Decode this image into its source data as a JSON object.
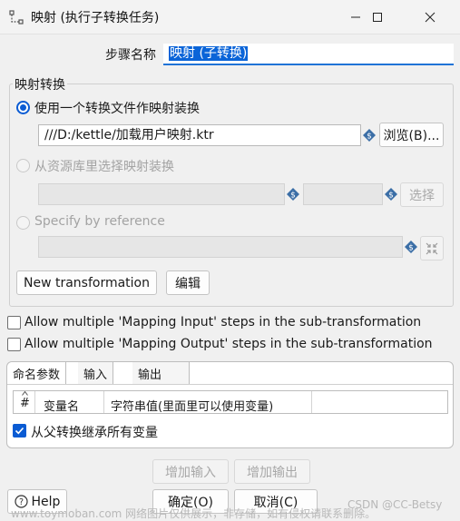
{
  "window": {
    "title": "映射 (执行子转换任务)",
    "controls": {
      "minimize": "minimize-icon",
      "maximize": "maximize-icon",
      "close": "close-icon"
    }
  },
  "step": {
    "label": "步骤名称",
    "value": "映射 (子转换)"
  },
  "mapping_group": {
    "title": "映射转换",
    "option_file": {
      "label": "使用一个转换文件作映射装换",
      "selected": true,
      "path": "///D:/kettle/加载用户映射.ktr",
      "browse_label": "浏览(B)..."
    },
    "option_repo": {
      "label": "从资源库里选择映射装换",
      "selected": false,
      "select_label": "选择"
    },
    "option_ref": {
      "label": "Specify by reference",
      "selected": false
    },
    "new_transformation_label": "New transformation",
    "edit_label": "编辑"
  },
  "checkboxes": {
    "multi_input": {
      "label": "Allow multiple 'Mapping Input' steps in the sub-transformation",
      "checked": false
    },
    "multi_output": {
      "label": "Allow multiple 'Mapping Output' steps in the sub-transformation",
      "checked": false
    }
  },
  "tabs": {
    "items": [
      {
        "label": "命名参数",
        "active": true
      },
      {
        "label": "输入",
        "active": false
      },
      {
        "label": "输出",
        "active": false
      }
    ],
    "table": {
      "columns": [
        "#",
        "变量名",
        "字符串值(里面里可以使用变量)"
      ]
    },
    "inherit_label": "从父转换继承所有变量",
    "inherit_checked": true
  },
  "buttons": {
    "add_input": "增加输入",
    "add_output": "增加输出",
    "help": "Help",
    "ok": "确定(O)",
    "cancel": "取消(C)"
  },
  "watermark": {
    "left": "www.toymoban.com 网络图片仅供展示，非存储，如有侵权请联系删除。",
    "right": "CSDN @CC-Betsy"
  },
  "colors": {
    "accent": "#0a5bd3",
    "selection": "#0a64d8"
  }
}
